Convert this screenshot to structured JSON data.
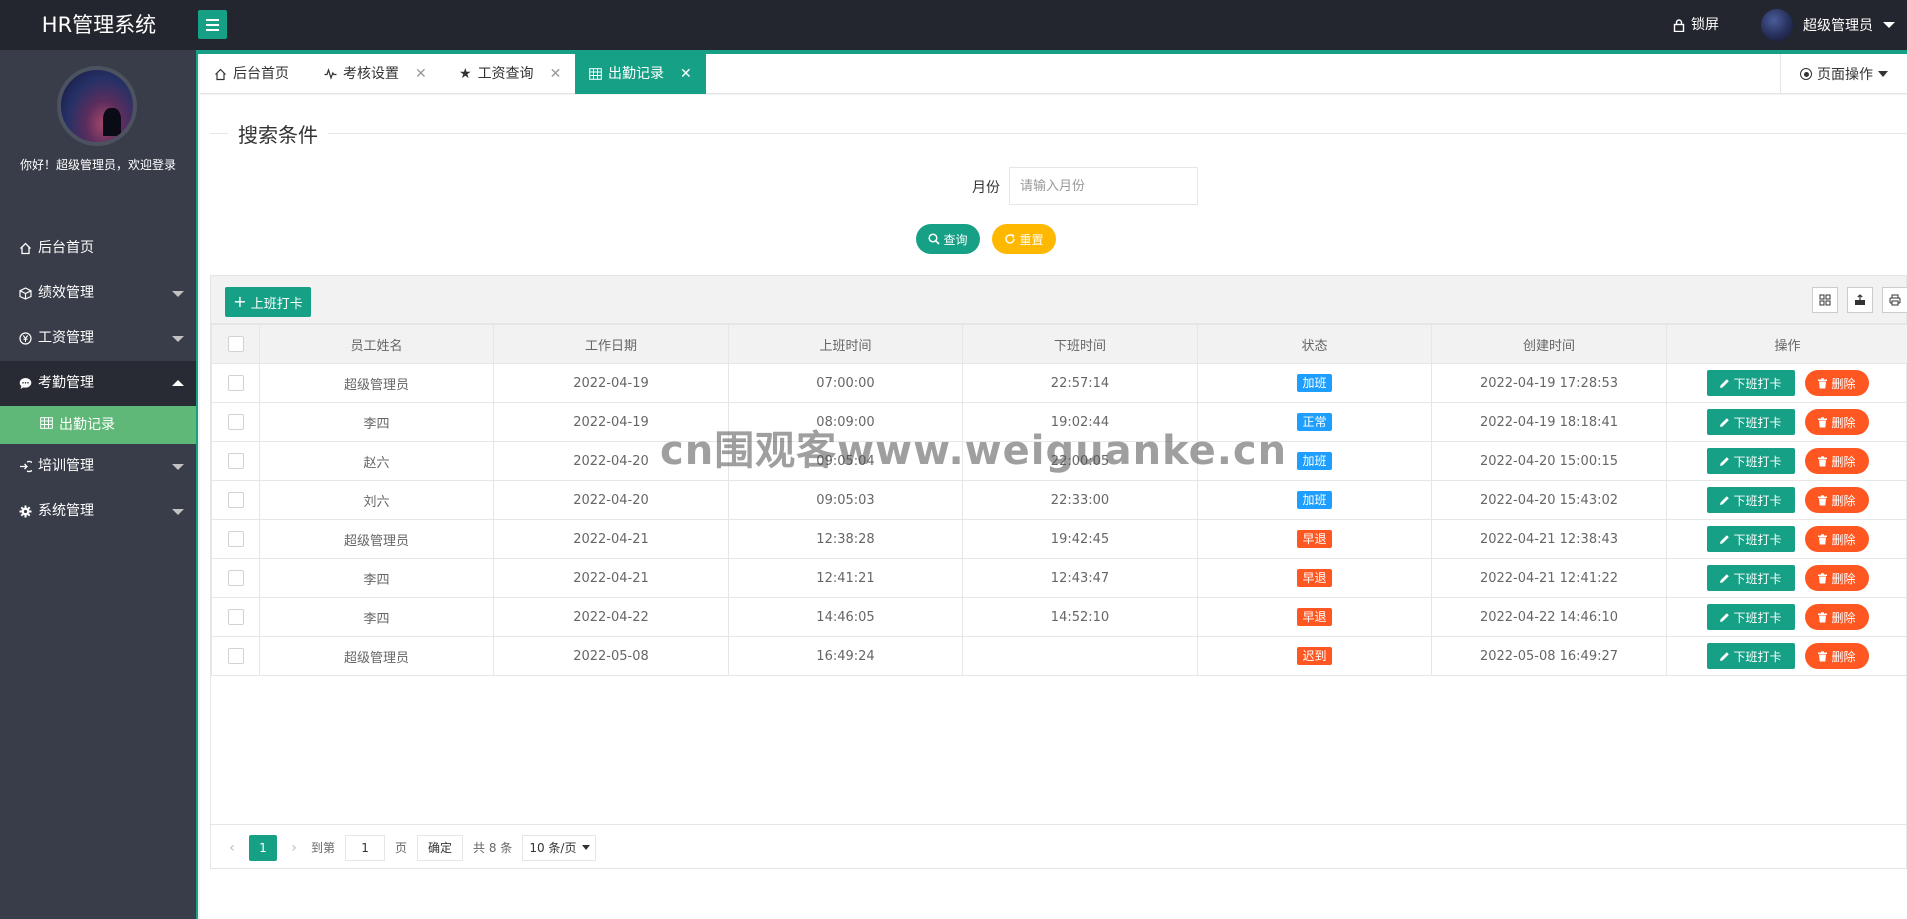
{
  "header": {
    "logo": "HR管理系统",
    "lock_label": "锁屏",
    "user_name": "超级管理员"
  },
  "sidebar": {
    "welcome": "你好！超级管理员，欢迎登录",
    "items": [
      {
        "label": "后台首页",
        "icon": "home-icon"
      },
      {
        "label": "绩效管理",
        "icon": "cube-icon"
      },
      {
        "label": "工资管理",
        "icon": "yen-icon"
      },
      {
        "label": "考勤管理",
        "icon": "chat-icon"
      },
      {
        "label": "培训管理",
        "icon": "login-icon"
      },
      {
        "label": "系统管理",
        "icon": "gear-icon"
      }
    ],
    "sub_item": {
      "label": "出勤记录",
      "icon": "table-icon"
    }
  },
  "tabs": [
    {
      "label": "后台首页",
      "icon": "home-icon"
    },
    {
      "label": "考核设置",
      "icon": "pulse-icon"
    },
    {
      "label": "工资查询",
      "icon": "star-icon"
    },
    {
      "label": "出勤记录",
      "icon": "table-icon"
    }
  ],
  "page_ops": "页面操作",
  "search": {
    "title": "搜索条件",
    "month_label": "月份",
    "month_placeholder": "请输入月份",
    "query_label": "查询",
    "reset_label": "重置"
  },
  "toolbar": {
    "checkin_label": "上班打卡"
  },
  "table": {
    "headers": [
      "员工姓名",
      "工作日期",
      "上班时间",
      "下班时间",
      "状态",
      "创建时间",
      "操作"
    ],
    "rows": [
      {
        "name": "超级管理员",
        "date": "2022-04-19",
        "in": "07:00:00",
        "out": "22:57:14",
        "status": "加班",
        "status_color": "#1e9fff",
        "created": "2022-04-19 17:28:53"
      },
      {
        "name": "李四",
        "date": "2022-04-19",
        "in": "08:09:00",
        "out": "19:02:44",
        "status": "正常",
        "status_color": "#1e9fff",
        "created": "2022-04-19 18:18:41"
      },
      {
        "name": "赵六",
        "date": "2022-04-20",
        "in": "09:05:04",
        "out": "22:00:05",
        "status": "加班",
        "status_color": "#1e9fff",
        "created": "2022-04-20 15:00:15"
      },
      {
        "name": "刘六",
        "date": "2022-04-20",
        "in": "09:05:03",
        "out": "22:33:00",
        "status": "加班",
        "status_color": "#1e9fff",
        "created": "2022-04-20 15:43:02"
      },
      {
        "name": "超级管理员",
        "date": "2022-04-21",
        "in": "12:38:28",
        "out": "19:42:45",
        "status": "早退",
        "status_color": "#ff5722",
        "created": "2022-04-21 12:38:43"
      },
      {
        "name": "李四",
        "date": "2022-04-21",
        "in": "12:41:21",
        "out": "12:43:47",
        "status": "早退",
        "status_color": "#ff5722",
        "created": "2022-04-21 12:41:22"
      },
      {
        "name": "李四",
        "date": "2022-04-22",
        "in": "14:46:05",
        "out": "14:52:10",
        "status": "早退",
        "status_color": "#ff5722",
        "created": "2022-04-22 14:46:10"
      },
      {
        "name": "超级管理员",
        "date": "2022-05-08",
        "in": "16:49:24",
        "out": "",
        "status": "迟到",
        "status_color": "#ff5722",
        "created": "2022-05-08 16:49:27"
      }
    ],
    "op_out_label": "下班打卡",
    "op_delete_label": "删除"
  },
  "pager": {
    "current": "1",
    "goto_prefix": "到第",
    "goto_value": "1",
    "goto_suffix": "页",
    "confirm": "确定",
    "total": "共 8 条",
    "limit": "10 条/页"
  },
  "watermark": "cn围观客www.weiguanke.cn",
  "colors": {
    "accent": "#16a086",
    "warning": "#ffb800",
    "danger": "#ff5722",
    "info": "#1e9fff",
    "sidebar": "#393d49",
    "active_sub": "#5fb878"
  }
}
